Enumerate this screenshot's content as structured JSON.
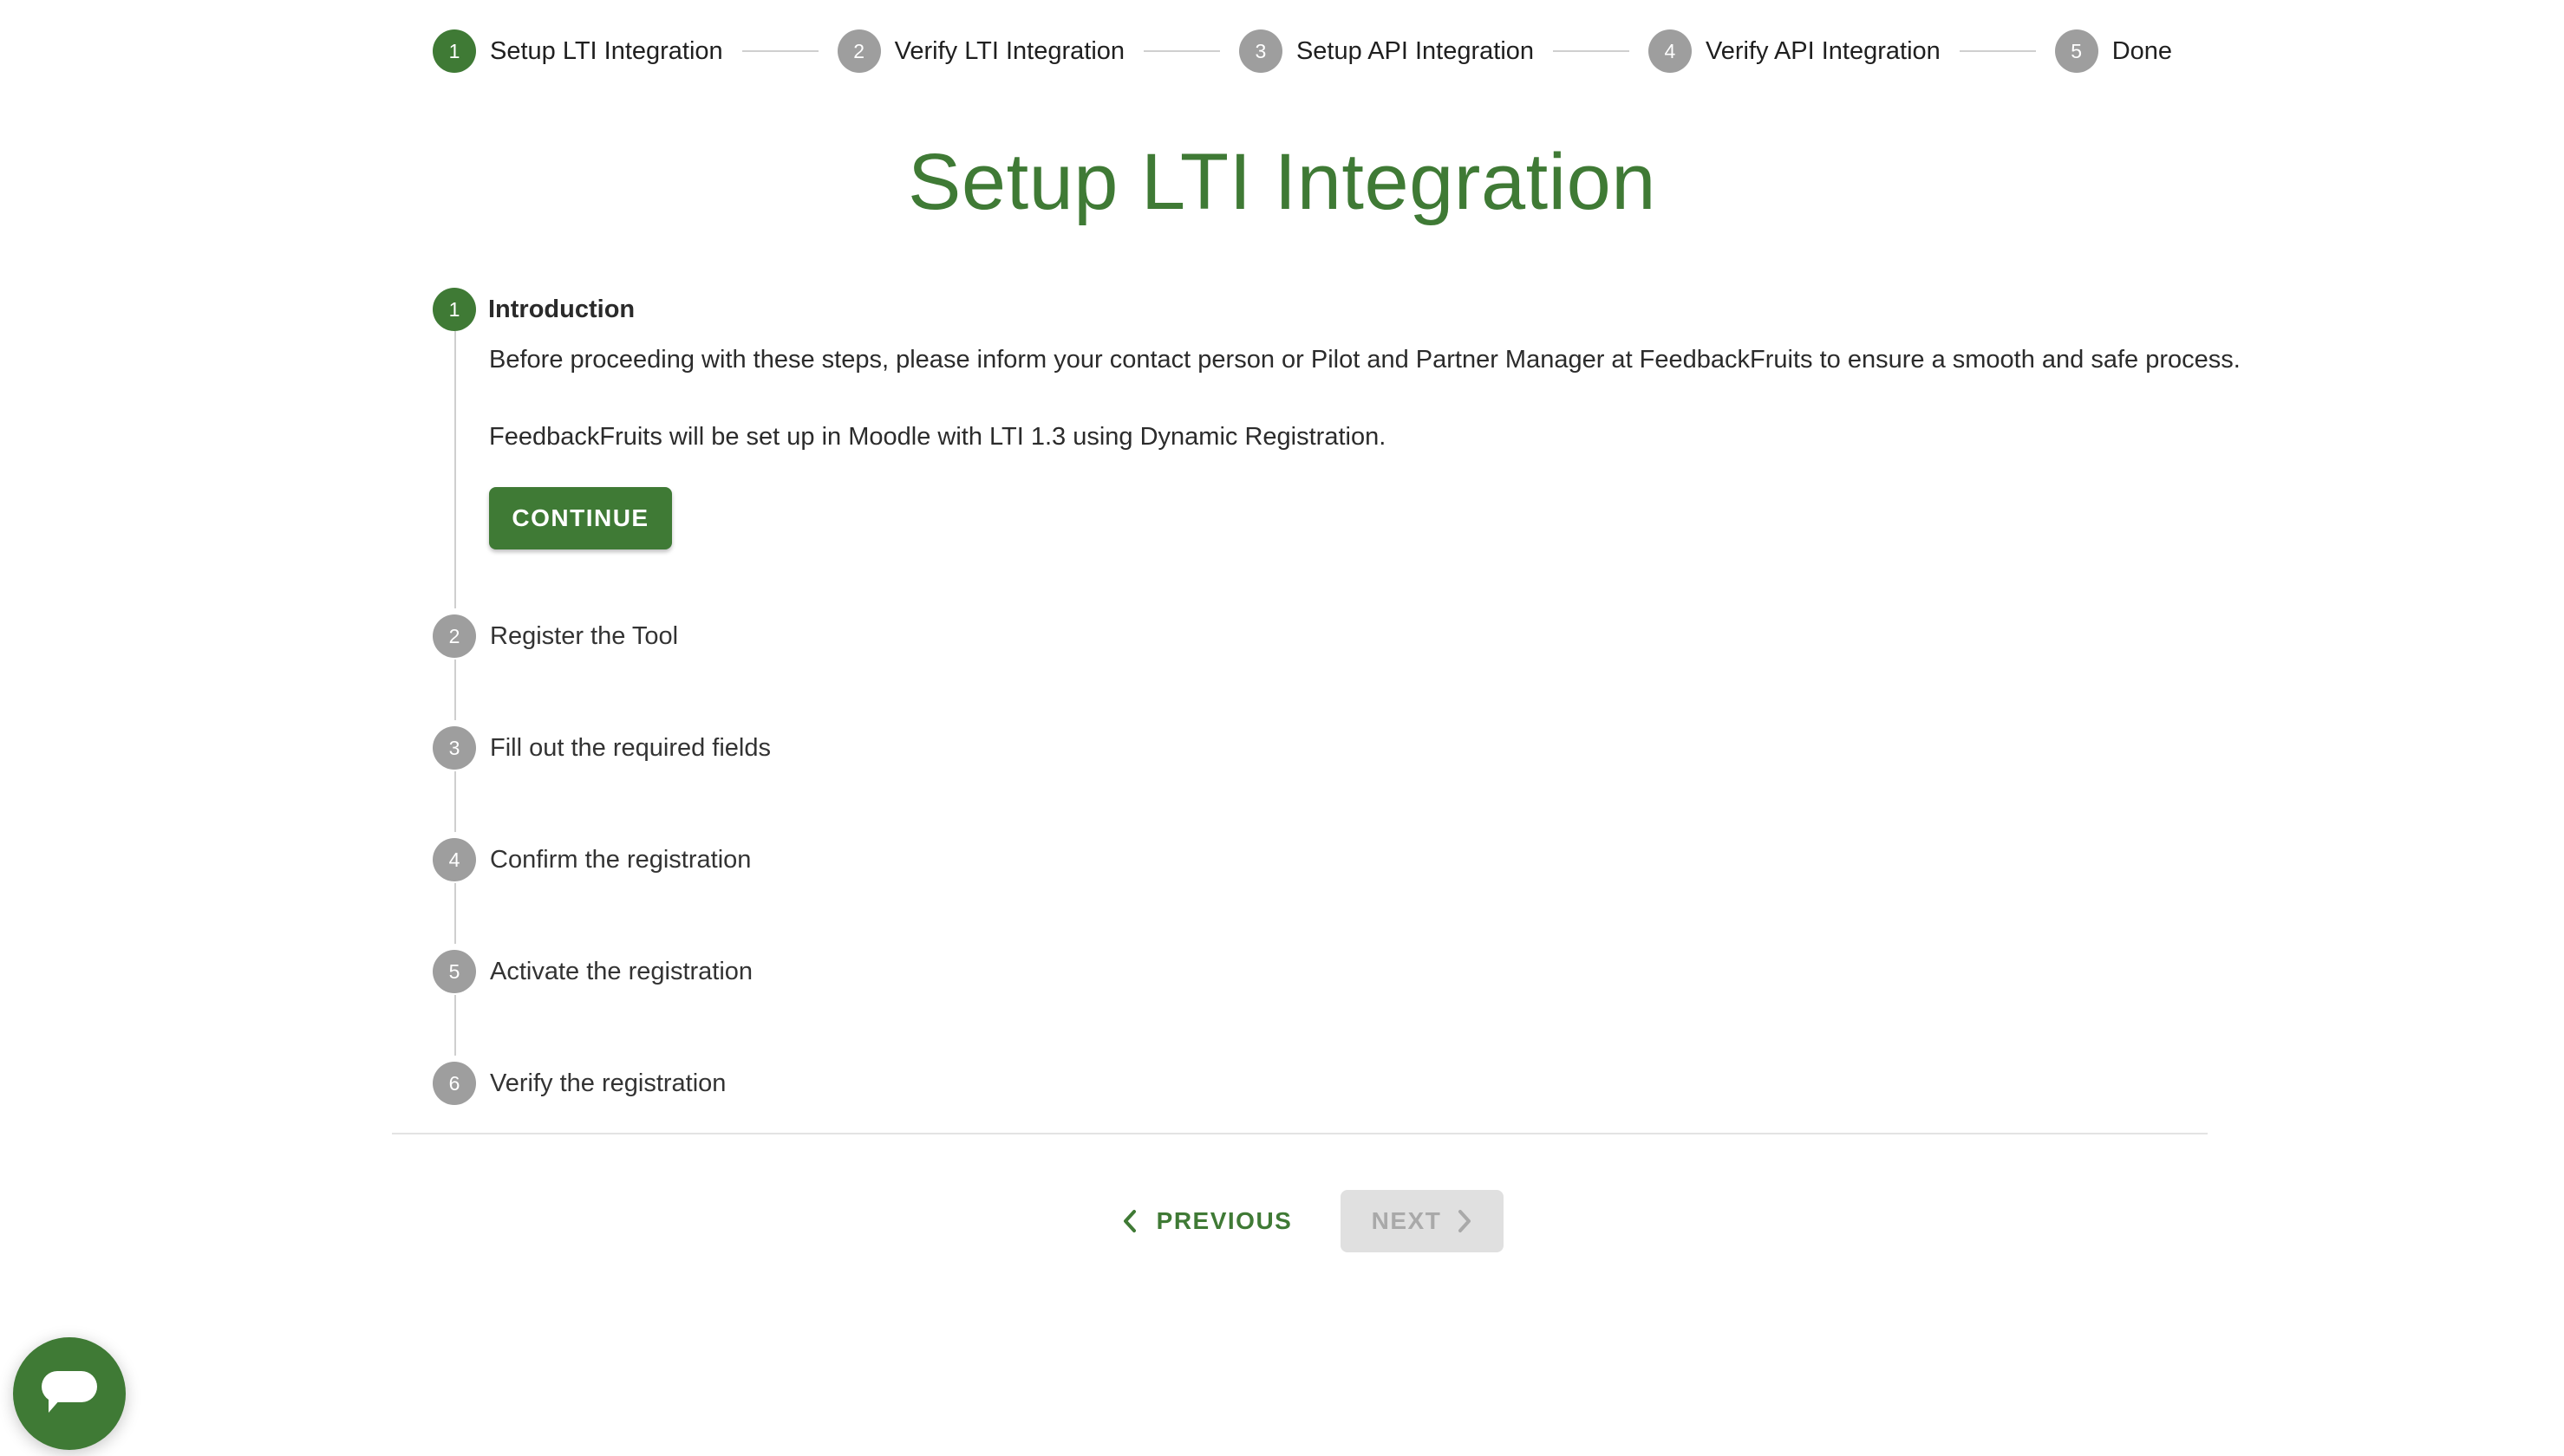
{
  "top_stepper": {
    "steps": [
      {
        "number": "1",
        "label": "Setup LTI Integration",
        "state": "active"
      },
      {
        "number": "2",
        "label": "Verify LTI Integration",
        "state": "inactive"
      },
      {
        "number": "3",
        "label": "Setup API Integration",
        "state": "inactive"
      },
      {
        "number": "4",
        "label": "Verify API Integration",
        "state": "inactive"
      },
      {
        "number": "5",
        "label": "Done",
        "state": "inactive"
      }
    ]
  },
  "main": {
    "title": "Setup LTI Integration",
    "steps": [
      {
        "number": "1",
        "label": "Introduction",
        "state": "active"
      },
      {
        "number": "2",
        "label": "Register the Tool",
        "state": "inactive"
      },
      {
        "number": "3",
        "label": "Fill out the required fields",
        "state": "inactive"
      },
      {
        "number": "4",
        "label": "Confirm the registration",
        "state": "inactive"
      },
      {
        "number": "5",
        "label": "Activate the registration",
        "state": "inactive"
      },
      {
        "number": "6",
        "label": "Verify the registration",
        "state": "inactive"
      }
    ],
    "intro": {
      "paragraph_1": "Before proceeding with these steps, please inform your contact person or Pilot and Partner Manager at FeedbackFruits to ensure a smooth and safe process.",
      "paragraph_2": "FeedbackFruits will be set up in Moodle with LTI 1.3 using Dynamic Registration.",
      "continue_label": "CONTINUE"
    }
  },
  "navigation": {
    "previous_label": "PREVIOUS",
    "next_label": "NEXT",
    "next_disabled": true,
    "previous_icon": "chevron-left-icon",
    "next_icon": "chevron-right-icon"
  },
  "chat": {
    "icon": "chat-bubble-icon"
  },
  "colors": {
    "accent": "#3f7a35",
    "inactive_step": "#9e9e9e",
    "disabled_button": "#e0e0e0",
    "connector": "#cfcfcf"
  }
}
